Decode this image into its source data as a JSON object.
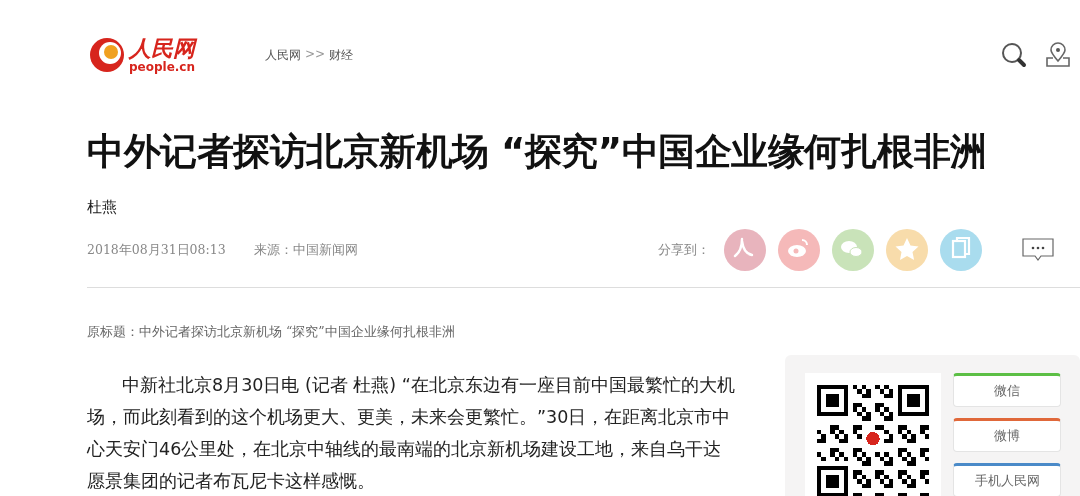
{
  "header": {
    "logo": {
      "name": "人民网",
      "domain": "people.cn"
    },
    "breadcrumb": [
      {
        "label": "人民网",
        "kind": "link"
      },
      {
        "label": ">>",
        "kind": "separator"
      },
      {
        "label": "财经",
        "kind": "link"
      }
    ]
  },
  "article": {
    "title": "中外记者探访北京新机场 “探究”中国企业缘何扎根非洲",
    "author": "杜燕",
    "date": "2018年08月31日08:13",
    "source": "来源：中国新闻网",
    "share_label": "分享到：",
    "share_buttons": [
      {
        "kind": "people",
        "color": "#e8b4bd"
      },
      {
        "kind": "weibo",
        "color": "#f5b9b9"
      },
      {
        "kind": "wechat",
        "color": "#c9e3b9"
      },
      {
        "kind": "qzone",
        "color": "#f8dcab"
      },
      {
        "kind": "copy",
        "color": "#a9dcee"
      }
    ],
    "original_title": "原标题：中外记者探访北京新机场 “探究”中国企业缘何扎根非洲",
    "paragraphs": [
      "中新社北京8月30日电 (记者 杜燕) “在北京东边有一座目前中国最繁忙的大机场，而此刻看到的这个机场更大、更美，未来会更繁忙。”30日，在距离北京市中心天安门46公里处，在北京中轴线的最南端的北京新机场建设工地，来自乌干达愿景集团的记者布瓦尼卡这样感慨。"
    ]
  },
  "sidebar": {
    "buttons": [
      {
        "label": "微信",
        "color": "#5cbf45"
      },
      {
        "label": "微博",
        "color": "#e0683a"
      },
      {
        "label": "手机人民网",
        "color": "#4a8ac8"
      }
    ]
  }
}
